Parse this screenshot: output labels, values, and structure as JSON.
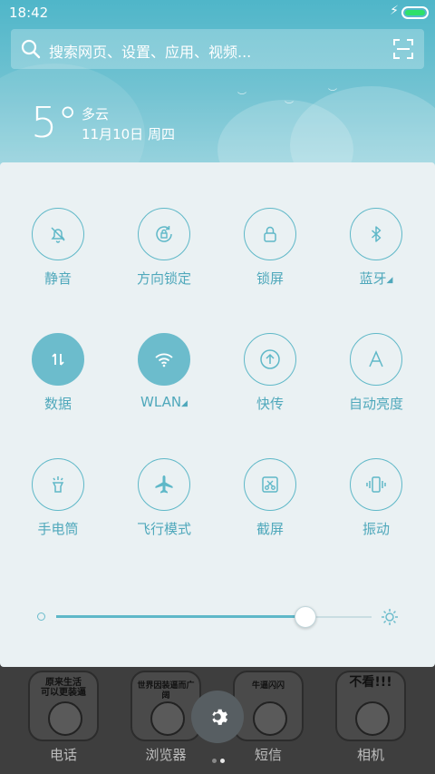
{
  "status_bar": {
    "time": "18:42",
    "charging_icon": "lightning-icon",
    "battery_color": "#2ee06a"
  },
  "search": {
    "placeholder": "搜索网页、设置、应用、视频..."
  },
  "weather": {
    "temperature": "5°",
    "condition": "多云",
    "date": "11月10日 周四"
  },
  "toggles": [
    {
      "label": "静音",
      "icon": "mute-bell-icon",
      "active": false
    },
    {
      "label": "方向锁定",
      "icon": "rotation-lock-icon",
      "active": false
    },
    {
      "label": "锁屏",
      "icon": "lock-icon",
      "active": false
    },
    {
      "label": "蓝牙",
      "icon": "bluetooth-icon",
      "active": false,
      "has_menu": true
    },
    {
      "label": "数据",
      "icon": "mobile-data-icon",
      "active": true
    },
    {
      "label": "WLAN",
      "icon": "wifi-icon",
      "active": true,
      "has_menu": true
    },
    {
      "label": "快传",
      "icon": "quick-transfer-icon",
      "active": false
    },
    {
      "label": "自动亮度",
      "icon": "auto-brightness-icon",
      "active": false
    },
    {
      "label": "手电筒",
      "icon": "flashlight-icon",
      "active": false
    },
    {
      "label": "飞行模式",
      "icon": "airplane-icon",
      "active": false
    },
    {
      "label": "截屏",
      "icon": "screenshot-icon",
      "active": false
    },
    {
      "label": "振动",
      "icon": "vibrate-icon",
      "active": false
    }
  ],
  "brightness": {
    "level": 0.79
  },
  "dock": {
    "apps": [
      {
        "label": "电话",
        "meme_text": "原来生活\n可以更装逼"
      },
      {
        "label": "浏览器",
        "meme_text": "世界因装逼而广阔"
      },
      {
        "label": "短信",
        "meme_text": "牛逼闪闪"
      },
      {
        "label": "相机",
        "meme_text": "不看!!!"
      }
    ]
  },
  "accent_color": "#5fb8c8"
}
